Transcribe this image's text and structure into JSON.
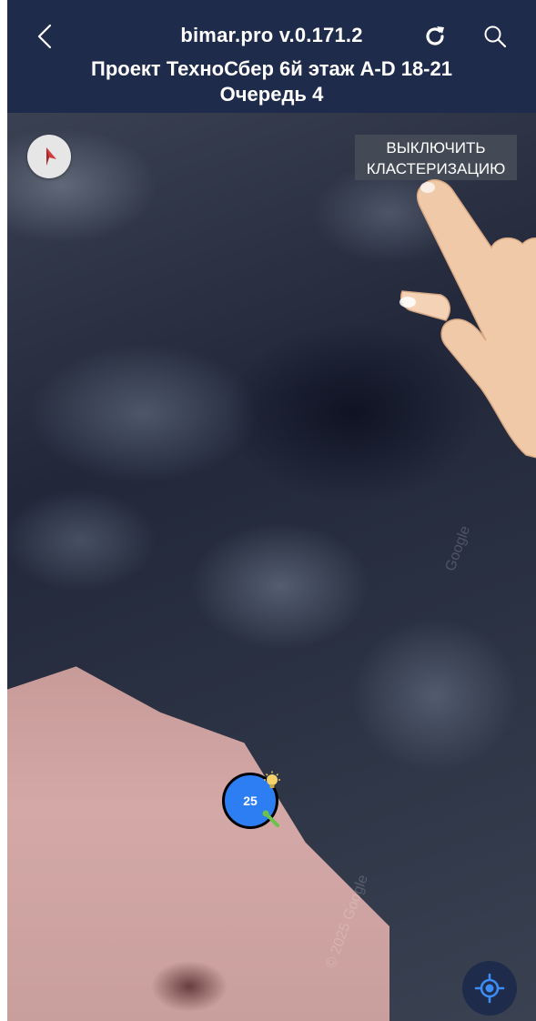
{
  "header": {
    "app_title": "bimar.pro v.0.171.2",
    "project_title_line1": "Проект ТехноСбер 6й этаж A-D 18-21",
    "project_title_line2": "Очередь 4",
    "icons": {
      "back": "chevron-left-icon",
      "refresh": "refresh-icon",
      "search": "search-icon"
    }
  },
  "map": {
    "cluster_toggle_line1": "ВЫКЛЮЧИТЬ",
    "cluster_toggle_line2": "КЛАСТЕРИЗАЦИЮ",
    "cluster_count": "25",
    "watermark_1": "© 2025 Google",
    "watermark_2": "Google",
    "icons": {
      "compass": "compass-icon",
      "bulb": "lightbulb-icon",
      "tool": "wrench-icon",
      "locate": "my-location-icon"
    }
  },
  "colors": {
    "header_bg": "#1f2b4a",
    "cluster_marker": "#2d7ef2",
    "locate_button": "#1f2b4a",
    "compass_needle": "#d43c3c"
  }
}
